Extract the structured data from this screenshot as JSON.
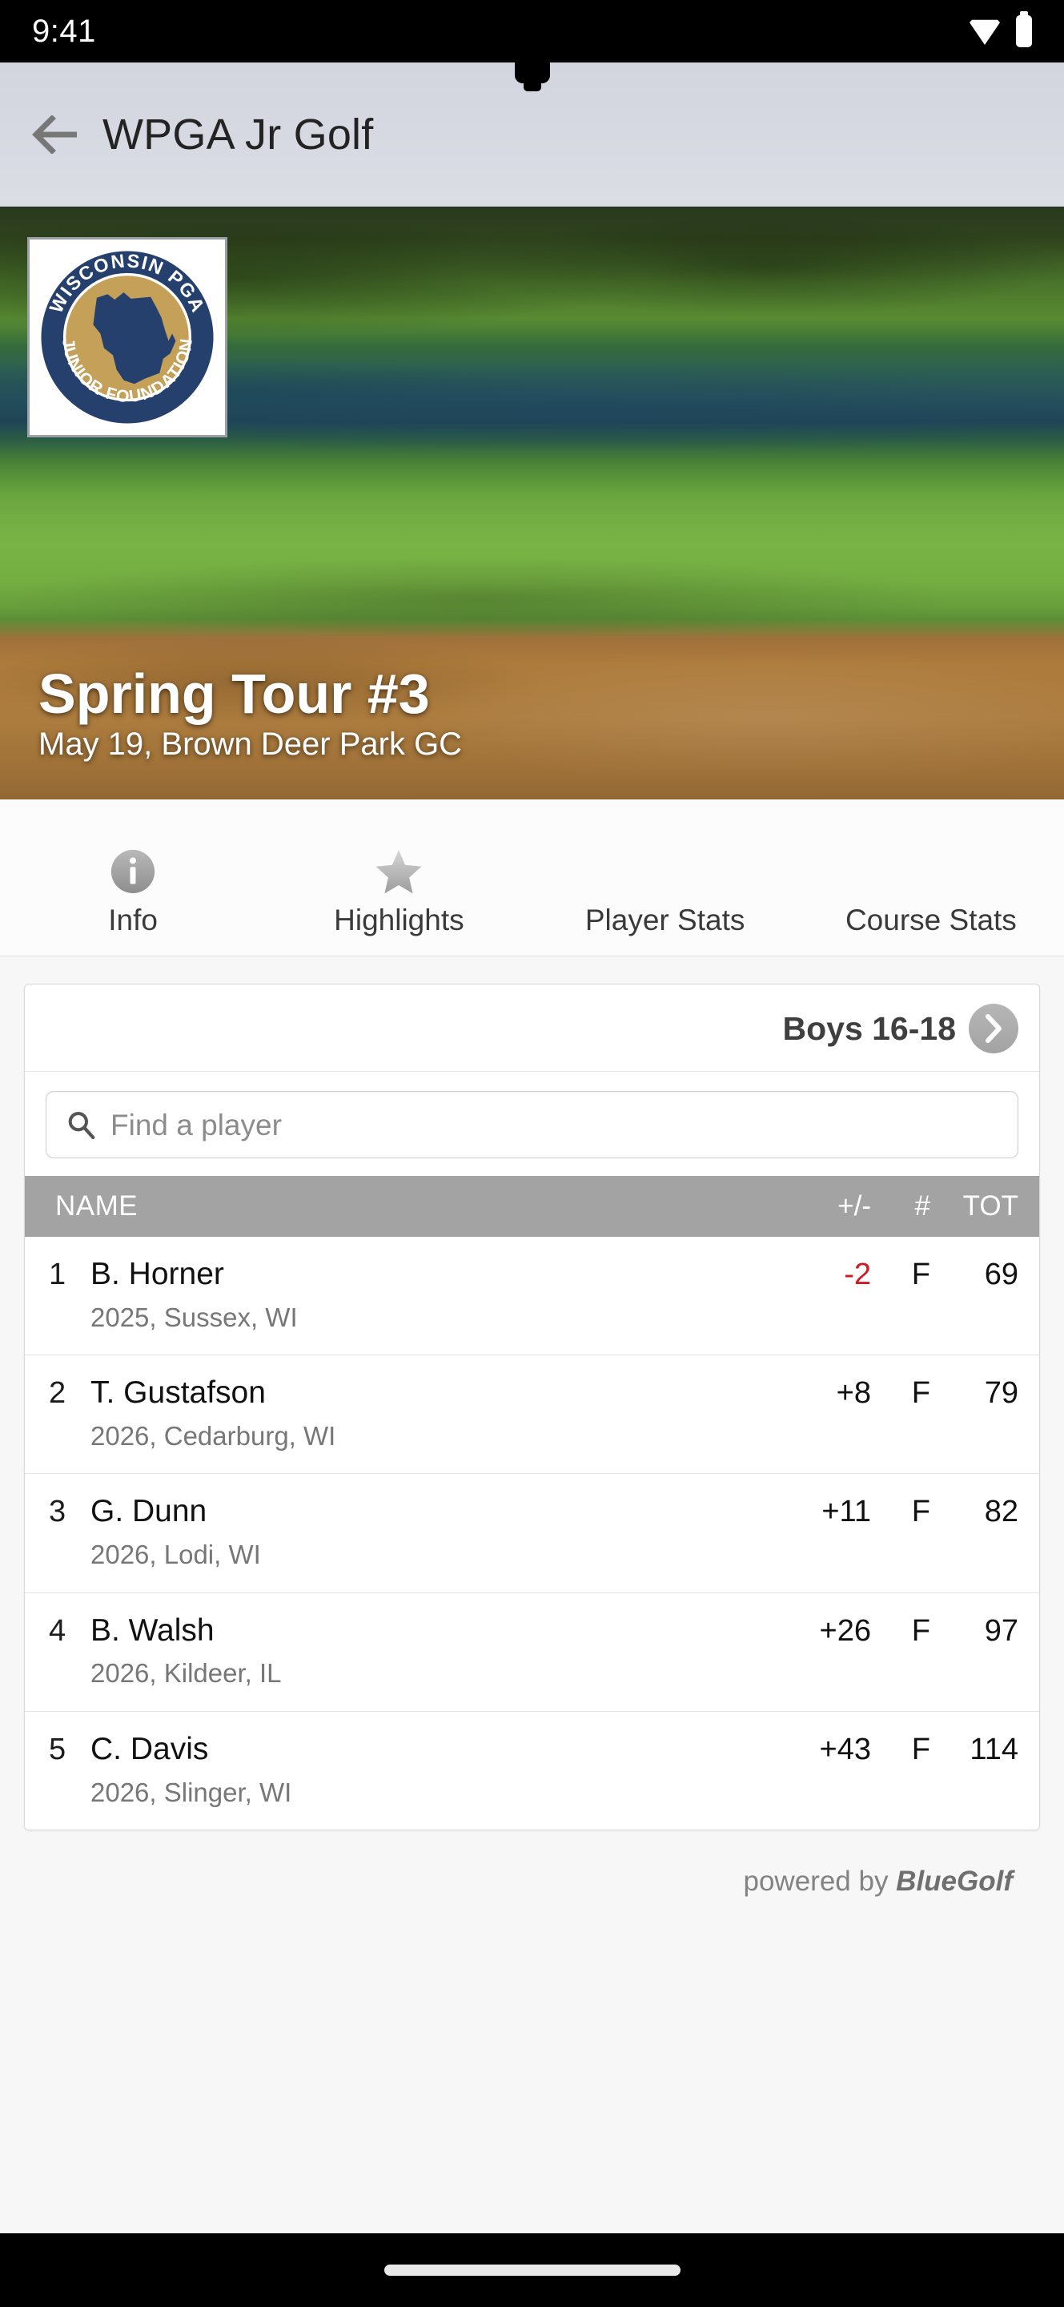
{
  "status_bar": {
    "time": "9:41",
    "wifi_icon": "wifi-icon",
    "battery_icon": "battery-icon"
  },
  "app_bar": {
    "back_icon": "back-arrow-icon",
    "title": "WPGA Jr Golf"
  },
  "hero": {
    "logo_alt": "Wisconsin PGA Junior Foundation",
    "logo_text_top": "WISCONSIN PGA",
    "logo_text_bottom": "JUNIOR FOUNDATION",
    "title": "Spring Tour #3",
    "subtitle": "May 19, Brown Deer Park GC"
  },
  "tabs": [
    {
      "label": "Info",
      "icon": "info-circle-icon"
    },
    {
      "label": "Highlights",
      "icon": "star-icon"
    },
    {
      "label": "Player Stats",
      "icon": ""
    },
    {
      "label": "Course Stats",
      "icon": ""
    }
  ],
  "leaderboard": {
    "division": "Boys 16-18",
    "next_icon": "chevron-right-icon",
    "search": {
      "icon": "search-icon",
      "placeholder": "Find a player",
      "value": ""
    },
    "columns": {
      "name": "NAME",
      "to_par": "+/-",
      "thru": "#",
      "total": "TOT"
    },
    "rows": [
      {
        "pos": "1",
        "name": "B. Horner",
        "meta": "2025, Sussex, WI",
        "to_par": "-2",
        "thru": "F",
        "total": "69",
        "under_par": true
      },
      {
        "pos": "2",
        "name": "T. Gustafson",
        "meta": "2026, Cedarburg, WI",
        "to_par": "+8",
        "thru": "F",
        "total": "79",
        "under_par": false
      },
      {
        "pos": "3",
        "name": "G. Dunn",
        "meta": "2026, Lodi, WI",
        "to_par": "+11",
        "thru": "F",
        "total": "82",
        "under_par": false
      },
      {
        "pos": "4",
        "name": "B. Walsh",
        "meta": "2026, Kildeer, IL",
        "to_par": "+26",
        "thru": "F",
        "total": "97",
        "under_par": false
      },
      {
        "pos": "5",
        "name": "C. Davis",
        "meta": "2026, Slinger, WI",
        "to_par": "+43",
        "thru": "F",
        "total": "114",
        "under_par": false
      }
    ]
  },
  "footer": {
    "powered_prefix": "powered by ",
    "powered_brand": "BlueGolf"
  },
  "colors": {
    "under_par_red": "#cf1b25",
    "table_header_gray": "#a3a3a3",
    "app_bar_gray": "#d8dae3",
    "logo_navy": "#26406e",
    "logo_gold": "#c4a059"
  }
}
